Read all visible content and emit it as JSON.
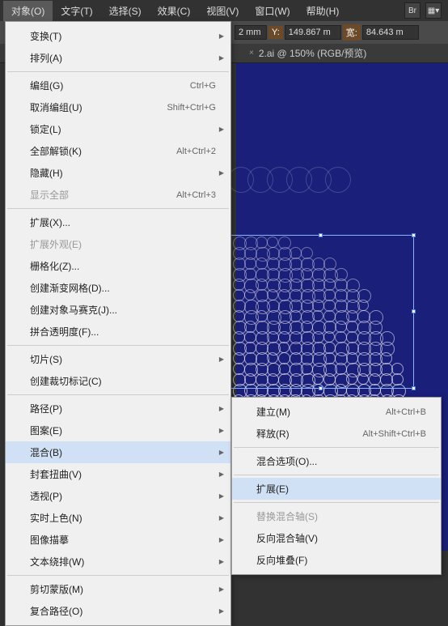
{
  "menubar": {
    "items": [
      "对象(O)",
      "文字(T)",
      "选择(S)",
      "效果(C)",
      "视图(V)",
      "窗口(W)",
      "帮助(H)"
    ],
    "icons": [
      "Br",
      "▦▾"
    ]
  },
  "controlbar": {
    "x_suffix": "2 mm",
    "y_label": "Y:",
    "y_value": "149.867 m",
    "w_label": "宽:",
    "w_value": "84.643 m"
  },
  "tab": {
    "label": "2.ai @ 150% (RGB/预览)",
    "close": "×"
  },
  "menu": [
    {
      "label": "变换(T)",
      "sub": true
    },
    {
      "label": "排列(A)",
      "sub": true
    },
    {
      "sep": true
    },
    {
      "label": "编组(G)",
      "shortcut": "Ctrl+G"
    },
    {
      "label": "取消编组(U)",
      "shortcut": "Shift+Ctrl+G"
    },
    {
      "label": "锁定(L)",
      "sub": true
    },
    {
      "label": "全部解锁(K)",
      "shortcut": "Alt+Ctrl+2"
    },
    {
      "label": "隐藏(H)",
      "sub": true
    },
    {
      "label": "显示全部",
      "shortcut": "Alt+Ctrl+3",
      "disabled": true
    },
    {
      "sep": true
    },
    {
      "label": "扩展(X)..."
    },
    {
      "label": "扩展外观(E)",
      "disabled": true
    },
    {
      "label": "栅格化(Z)..."
    },
    {
      "label": "创建渐变网格(D)..."
    },
    {
      "label": "创建对象马赛克(J)..."
    },
    {
      "label": "拼合透明度(F)..."
    },
    {
      "sep": true
    },
    {
      "label": "切片(S)",
      "sub": true
    },
    {
      "label": "创建裁切标记(C)"
    },
    {
      "sep": true
    },
    {
      "label": "路径(P)",
      "sub": true
    },
    {
      "label": "图案(E)",
      "sub": true
    },
    {
      "label": "混合(B)",
      "sub": true,
      "hl": true
    },
    {
      "label": "封套扭曲(V)",
      "sub": true
    },
    {
      "label": "透视(P)",
      "sub": true
    },
    {
      "label": "实时上色(N)",
      "sub": true
    },
    {
      "label": "图像描摹",
      "sub": true
    },
    {
      "label": "文本绕排(W)",
      "sub": true
    },
    {
      "sep": true
    },
    {
      "label": "剪切蒙版(M)",
      "sub": true
    },
    {
      "label": "复合路径(O)",
      "sub": true
    }
  ],
  "submenu": [
    {
      "label": "建立(M)",
      "shortcut": "Alt+Ctrl+B"
    },
    {
      "label": "释放(R)",
      "shortcut": "Alt+Shift+Ctrl+B"
    },
    {
      "sep": true
    },
    {
      "label": "混合选项(O)..."
    },
    {
      "sep": true
    },
    {
      "label": "扩展(E)",
      "hl": true
    },
    {
      "sep": true
    },
    {
      "label": "替换混合轴(S)",
      "disabled": true
    },
    {
      "label": "反向混合轴(V)"
    },
    {
      "label": "反向堆叠(F)"
    }
  ]
}
